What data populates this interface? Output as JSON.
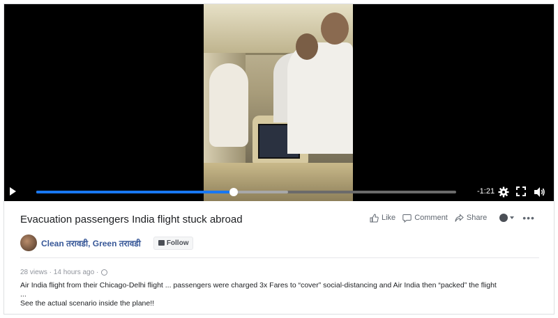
{
  "video": {
    "time_remaining": "-1:21",
    "progress": 0.47,
    "buffered": 0.6
  },
  "post": {
    "title": "Evacuation passengers India flight stuck abroad",
    "actions": {
      "like": "Like",
      "comment": "Comment",
      "share": "Share"
    },
    "page_name": "Clean तरावडी, Green तरावडी",
    "follow_label": "Follow",
    "views": "28 views",
    "time": "14 hours ago",
    "description": [
      "Air India flight from their Chicago-Delhi flight ... passengers were charged 3x Fares to “cover” social-distancing and Air India then “packed” the flight",
      "...",
      "See the actual scenario inside the plane!!"
    ]
  },
  "colors": {
    "progress_fill": "#1877f2",
    "link": "#385898"
  }
}
